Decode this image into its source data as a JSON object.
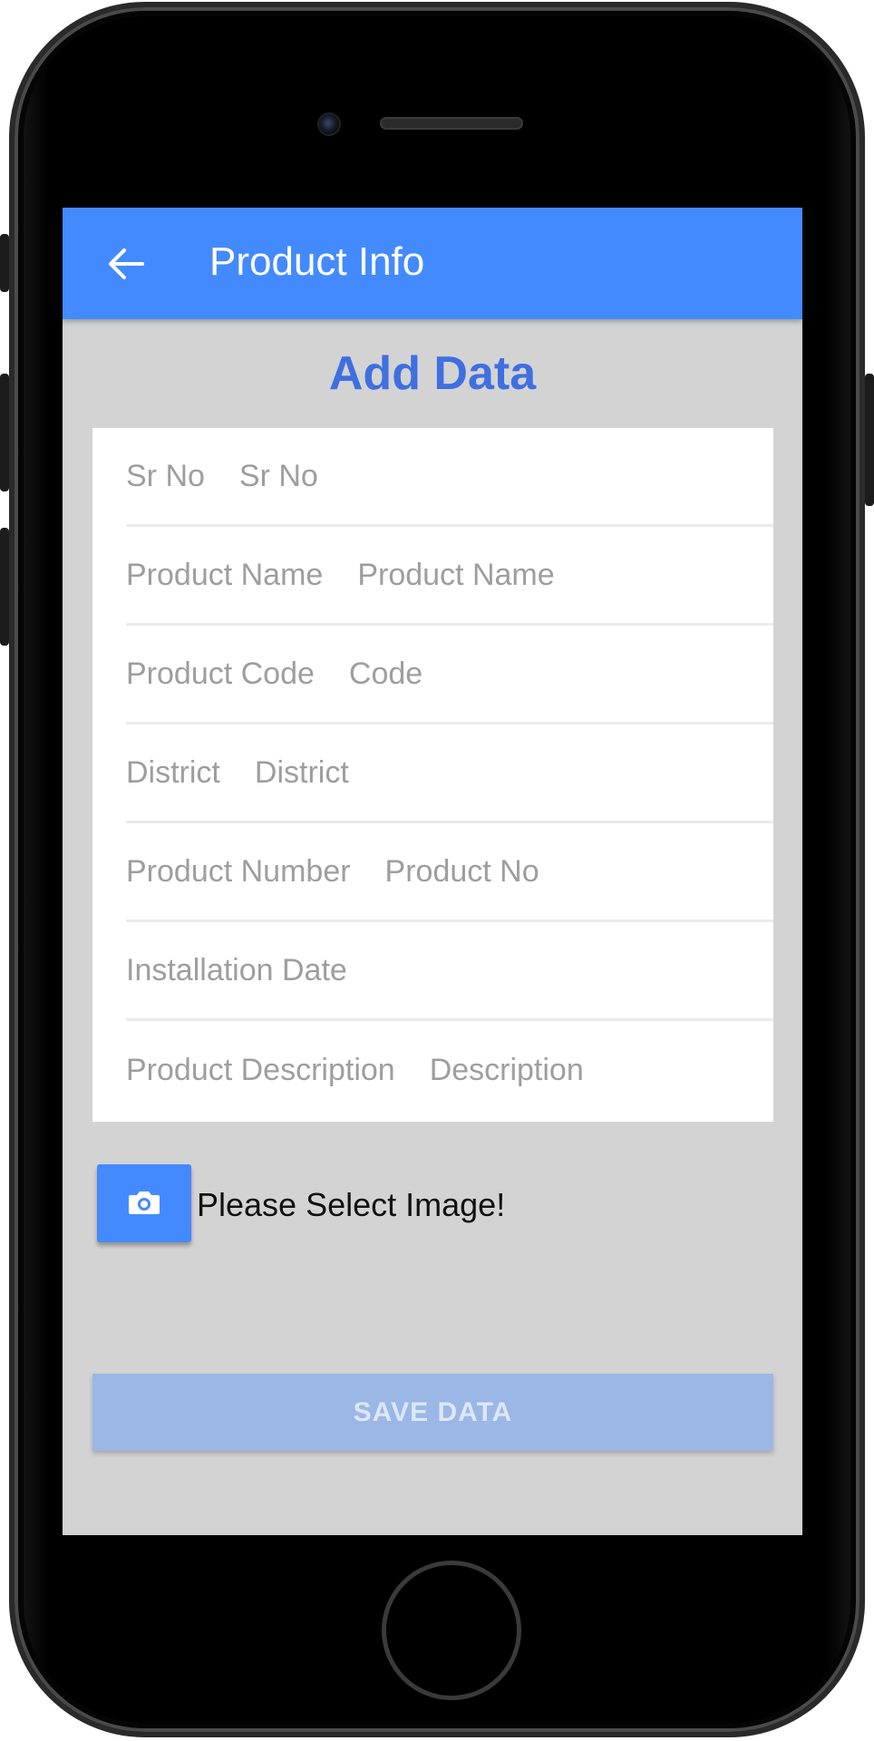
{
  "app_bar": {
    "title": "Product Info"
  },
  "page": {
    "heading": "Add Data"
  },
  "form": {
    "fields": [
      {
        "label": "Sr No",
        "placeholder": "Sr No"
      },
      {
        "label": "Product Name",
        "placeholder": "Product Name"
      },
      {
        "label": "Product Code",
        "placeholder": "Code"
      },
      {
        "label": "District",
        "placeholder": "District"
      },
      {
        "label": "Product Number",
        "placeholder": "Product No"
      },
      {
        "label": "Installation Date",
        "placeholder": ""
      },
      {
        "label": "Product Description",
        "placeholder": "Description"
      }
    ]
  },
  "image_picker": {
    "icon": "camera-icon",
    "prompt": "Please Select Image!"
  },
  "actions": {
    "save_label": "SAVE DATA"
  },
  "colors": {
    "primary": "#448aff",
    "heading": "#3f6fe0",
    "background": "#d3d3d3",
    "save_disabled": "#9bb7e6"
  }
}
